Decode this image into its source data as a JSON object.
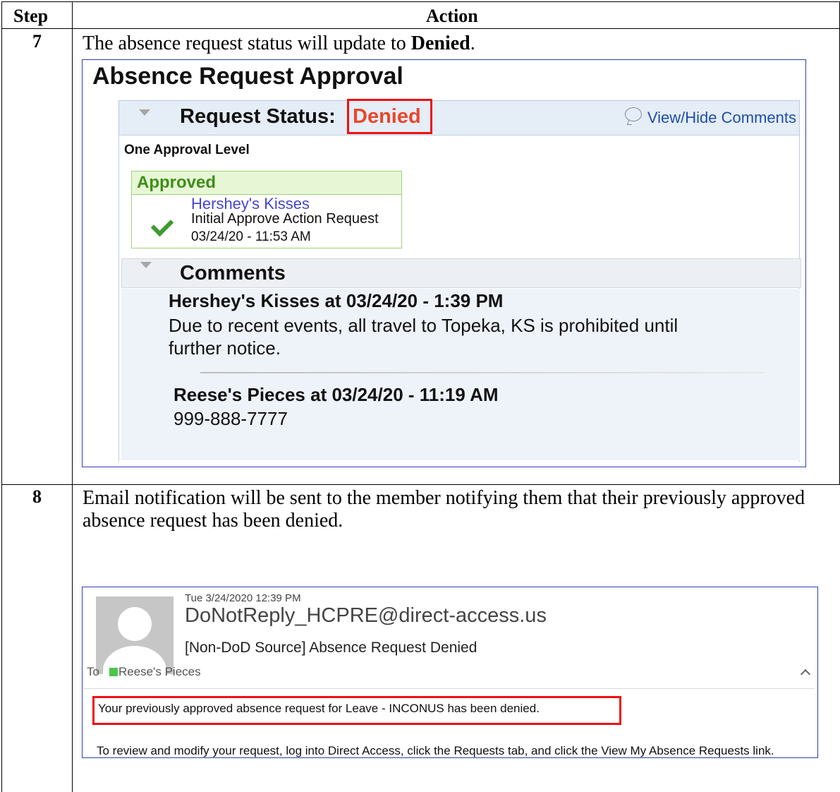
{
  "table": {
    "header_step": "Step",
    "header_action": "Action",
    "rows": [
      {
        "step": "7",
        "text_before": "The absence request status will update to ",
        "text_bold": "Denied",
        "text_after": "."
      },
      {
        "step": "8",
        "text": "Email notification will be sent to the member notifying them that their previously approved absence request has been denied."
      }
    ]
  },
  "approval": {
    "title": "Absence Request Approval",
    "status_label": "Request Status:",
    "status_value": "Denied",
    "view_hide": "View/Hide Comments",
    "level": "One Approval Level",
    "box_header": "Approved",
    "approver": "Hershey's Kisses",
    "action": "Initial Approve Action Request",
    "date": "03/24/20 - 11:53 AM",
    "comments_label": "Comments",
    "comments": [
      {
        "header": "Hershey's Kisses at 03/24/20 - 1:39 PM",
        "line1": "Due to recent events, all travel to Topeka, KS is prohibited until",
        "line2": "further notice."
      },
      {
        "header": "Reese's Pieces at 03/24/20 - 11:19 AM",
        "line1": "999-888-7777"
      }
    ]
  },
  "email": {
    "date": "Tue 3/24/2020 12:39 PM",
    "from": "DoNotReply_HCPRE@direct-access.us",
    "subject": "[Non-DoD Source] Absence Request Denied",
    "to_label": "To",
    "to_name": "Reese's Pieces",
    "body_line1": "Your previously approved absence request for Leave - INCONUS has been denied.",
    "body_line2": "To review and modify your request, log into Direct Access, click the Requests tab, and click the View My Absence Requests link."
  },
  "colors": {
    "denied": "#e8472a",
    "approved_green": "#3e8e17",
    "highlight_red": "#ee1111",
    "link_blue": "#1f4ea8"
  }
}
